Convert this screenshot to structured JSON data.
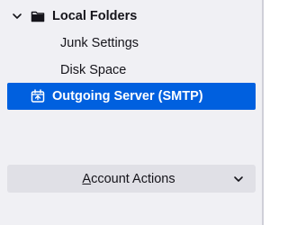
{
  "folders": {
    "local": {
      "label": "Local Folders",
      "expanded": true,
      "icon": "folder-icon",
      "twisty_icon": "chevron-down-icon"
    },
    "children": [
      {
        "label": "Junk Settings"
      },
      {
        "label": "Disk Space"
      }
    ],
    "outgoing": {
      "label": "Outgoing Server (SMTP)",
      "icon": "outgoing-server-icon",
      "selected": true
    }
  },
  "account_actions": {
    "label_prefix": "A",
    "label_rest": "ccount Actions",
    "dropdown_icon": "chevron-down-icon"
  },
  "colors": {
    "panel_bg": "#f0f0f4",
    "selection_bg": "#0060df",
    "button_bg": "#e0e0e6",
    "text": "#15141a"
  }
}
